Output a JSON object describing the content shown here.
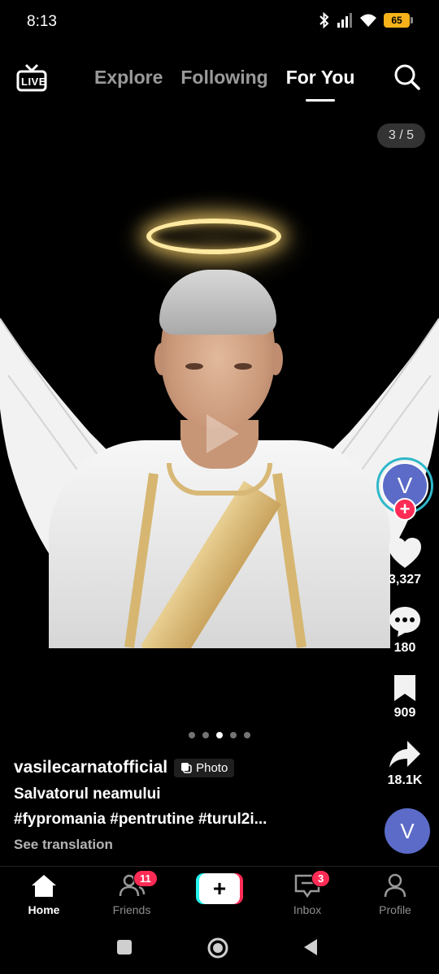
{
  "status_bar": {
    "time": "8:13",
    "battery": "65"
  },
  "top_nav": {
    "live_label": "LIVE",
    "tabs": [
      {
        "label": "Explore",
        "active": false
      },
      {
        "label": "Following",
        "active": false
      },
      {
        "label": "For You",
        "active": true
      }
    ]
  },
  "carousel": {
    "counter": "3 / 5",
    "total": 5,
    "current": 3
  },
  "actions": {
    "avatar_initial": "V",
    "likes": "3,327",
    "comments": "180",
    "saves": "909",
    "shares": "18.1K"
  },
  "caption": {
    "username": "vasilecarnatofficial",
    "badge": "Photo",
    "title": "Salvatorul neamului",
    "hashtags": "#fypromania #pentrutine #turul2i...",
    "see_translation": "See translation"
  },
  "music_avatar_initial": "V",
  "bottom_nav": {
    "home": "Home",
    "friends": "Friends",
    "friends_badge": "11",
    "inbox": "Inbox",
    "inbox_badge": "3",
    "profile": "Profile"
  },
  "colors": {
    "accent": "#fe2c55",
    "cyan": "#25f4ee",
    "avatar": "#5b6bc7"
  }
}
